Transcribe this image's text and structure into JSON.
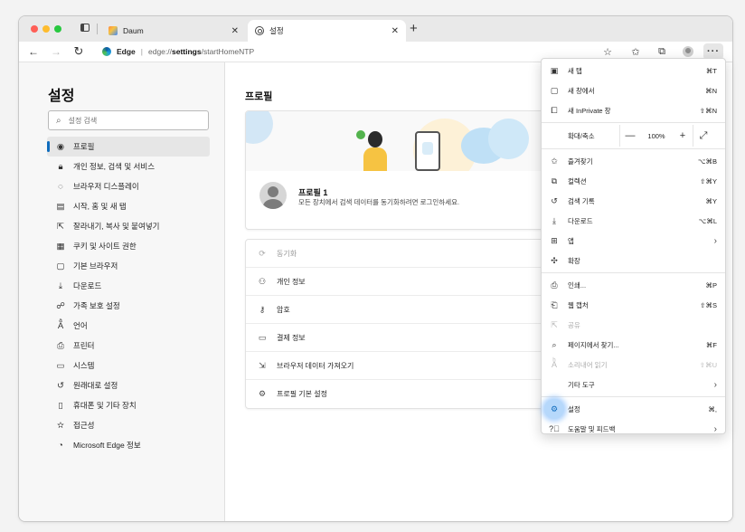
{
  "tabs": [
    {
      "title": "Daum",
      "favicon": "daum-favicon"
    },
    {
      "title": "설정",
      "favicon": "gear-icon"
    }
  ],
  "toolbar": {
    "site_label": "Edge",
    "url_host": "edge://",
    "url_bold": "settings",
    "url_rest": "/startHomeNTP"
  },
  "sidebar": {
    "title": "설정",
    "search_placeholder": "설정 검색",
    "items": [
      {
        "label": "프로필",
        "icon": "profile-icon",
        "selected": true
      },
      {
        "label": "개인 정보, 검색 및 서비스",
        "icon": "lock-icon"
      },
      {
        "label": "브라우저 디스플레이",
        "icon": "appearance-icon"
      },
      {
        "label": "시작, 홈 및 새 탭",
        "icon": "home-tab-icon"
      },
      {
        "label": "잘라내기, 복사 및 붙여넣기",
        "icon": "share-icon"
      },
      {
        "label": "쿠키 및 사이트 권한",
        "icon": "cookie-icon"
      },
      {
        "label": "기본 브라우저",
        "icon": "browser-icon"
      },
      {
        "label": "다운로드",
        "icon": "download-icon"
      },
      {
        "label": "가족 보호 설정",
        "icon": "family-icon"
      },
      {
        "label": "언어",
        "icon": "language-icon"
      },
      {
        "label": "프린터",
        "icon": "printer-icon"
      },
      {
        "label": "시스템",
        "icon": "laptop-icon"
      },
      {
        "label": "원래대로 설정",
        "icon": "reset-icon"
      },
      {
        "label": "휴대폰 및 기타 장치",
        "icon": "phone-icon"
      },
      {
        "label": "접근성",
        "icon": "accessibility-icon"
      },
      {
        "label": "Microsoft Edge 정보",
        "icon": "edge-icon"
      }
    ]
  },
  "main": {
    "title": "프로필",
    "profile_name": "프로필 1",
    "profile_desc": "모든 장치에서 검색 데이터를 동기화하려면 로그인하세요.",
    "rows": [
      {
        "label": "동기화",
        "icon": "sync-icon",
        "disabled": true
      },
      {
        "label": "개인 정보",
        "icon": "personal-info-icon"
      },
      {
        "label": "암호",
        "icon": "key-icon"
      },
      {
        "label": "결제 정보",
        "icon": "card-icon"
      },
      {
        "label": "브라우저 데이터 가져오기",
        "icon": "import-icon"
      },
      {
        "label": "프로필 기본 설정",
        "icon": "profile-settings-icon"
      }
    ]
  },
  "menu": {
    "new_tab": {
      "label": "새 탭",
      "shortcut": "⌘T"
    },
    "new_window": {
      "label": "새 창에서",
      "shortcut": "⌘N"
    },
    "inprivate": {
      "label": "새 InPrivate 창",
      "shortcut": "⇧⌘N"
    },
    "zoom": {
      "label": "확대/축소",
      "minus": "—",
      "value": "100%",
      "plus": "+",
      "full": "⤢"
    },
    "favorites": {
      "label": "즐겨찾기",
      "shortcut": "⌥⌘B"
    },
    "collections": {
      "label": "컬렉션",
      "shortcut": "⇧⌘Y"
    },
    "history": {
      "label": "검색 기록",
      "shortcut": "⌘Y"
    },
    "downloads": {
      "label": "다운로드",
      "shortcut": "⌥⌘L"
    },
    "apps": {
      "label": "앱",
      "arrow": "›"
    },
    "extensions": {
      "label": "확장"
    },
    "print": {
      "label": "인쇄...",
      "shortcut": "⌘P"
    },
    "web_capture": {
      "label": "웹 캡처",
      "shortcut": "⇧⌘S"
    },
    "share": {
      "label": "공유"
    },
    "find": {
      "label": "페이지에서 찾기...",
      "shortcut": "⌘F"
    },
    "read_aloud": {
      "label": "소리내어 읽기",
      "shortcut": "⇧⌘U"
    },
    "more_tools": {
      "label": "기타 도구",
      "arrow": "›"
    },
    "settings": {
      "label": "설정",
      "shortcut": "⌘,"
    },
    "help": {
      "label": "도움말 및 피드백",
      "arrow": "›"
    }
  },
  "colors": {
    "accent": "#0f6cbd",
    "sidebar_bg": "#f7f7f7"
  }
}
